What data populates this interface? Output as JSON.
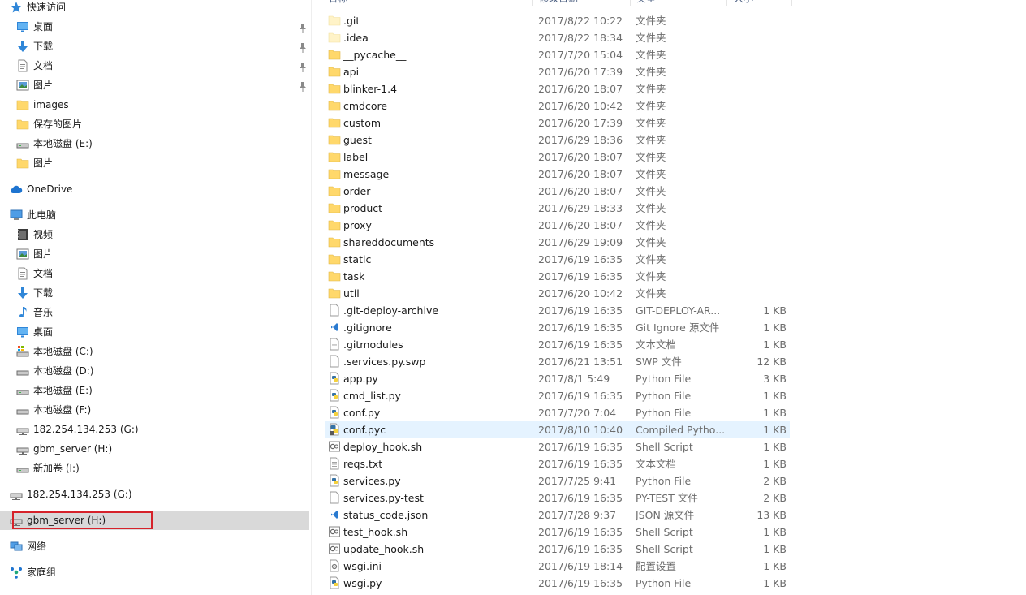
{
  "header": {
    "name": "名称",
    "date": "修改日期",
    "type": "类型",
    "size": "大小"
  },
  "colors": {
    "folder": "#ffd86b",
    "selection_nav": "#d9d9d9",
    "selection_row": "#e5f3ff",
    "focus_border": "#d6222a",
    "accent": "#1f6fcf"
  },
  "nav": [
    {
      "label": "快速访问",
      "icon": "star-icon",
      "indent": 0,
      "pinned": false
    },
    {
      "label": "桌面",
      "icon": "desktop-icon",
      "indent": 1,
      "pinned": true
    },
    {
      "label": "下载",
      "icon": "download-arrow-icon",
      "indent": 1,
      "pinned": true
    },
    {
      "label": "文档",
      "icon": "document-icon",
      "indent": 1,
      "pinned": true
    },
    {
      "label": "图片",
      "icon": "pictures-icon",
      "indent": 1,
      "pinned": true
    },
    {
      "label": "images",
      "icon": "folder-icon",
      "indent": 1,
      "pinned": false
    },
    {
      "label": "保存的图片",
      "icon": "folder-icon",
      "indent": 1,
      "pinned": false
    },
    {
      "label": "本地磁盘 (E:)",
      "icon": "drive-icon",
      "indent": 1,
      "pinned": false
    },
    {
      "label": "图片",
      "icon": "folder-icon",
      "indent": 1,
      "pinned": false
    },
    {
      "label": "OneDrive",
      "icon": "cloud-icon",
      "indent": 0,
      "pinned": false
    },
    {
      "label": "此电脑",
      "icon": "computer-icon",
      "indent": 0,
      "pinned": false
    },
    {
      "label": "视频",
      "icon": "video-icon",
      "indent": 1,
      "pinned": false
    },
    {
      "label": "图片",
      "icon": "pictures-icon",
      "indent": 1,
      "pinned": false
    },
    {
      "label": "文档",
      "icon": "document-icon",
      "indent": 1,
      "pinned": false
    },
    {
      "label": "下载",
      "icon": "download-arrow-icon",
      "indent": 1,
      "pinned": false
    },
    {
      "label": "音乐",
      "icon": "music-note-icon",
      "indent": 1,
      "pinned": false
    },
    {
      "label": "桌面",
      "icon": "desktop-icon",
      "indent": 1,
      "pinned": false
    },
    {
      "label": "本地磁盘 (C:)",
      "icon": "system-drive-icon",
      "indent": 1,
      "pinned": false
    },
    {
      "label": "本地磁盘 (D:)",
      "icon": "drive-icon",
      "indent": 1,
      "pinned": false
    },
    {
      "label": "本地磁盘 (E:)",
      "icon": "drive-icon",
      "indent": 1,
      "pinned": false
    },
    {
      "label": "本地磁盘 (F:)",
      "icon": "drive-icon",
      "indent": 1,
      "pinned": false
    },
    {
      "label": "182.254.134.253 (G:)",
      "icon": "network-drive-icon",
      "indent": 1,
      "pinned": false
    },
    {
      "label": "gbm_server (H:)",
      "icon": "network-drive-icon",
      "indent": 1,
      "pinned": false
    },
    {
      "label": "新加卷 (I:)",
      "icon": "drive-icon",
      "indent": 1,
      "pinned": false
    },
    {
      "label": "182.254.134.253 (G:)",
      "icon": "network-drive-icon",
      "indent": 0,
      "pinned": false
    },
    {
      "label": "gbm_server (H:)",
      "icon": "network-drive-icon",
      "indent": 0,
      "pinned": false,
      "selected": true
    },
    {
      "label": "网络",
      "icon": "network-icon",
      "indent": 0,
      "pinned": false
    },
    {
      "label": "家庭组",
      "icon": "homegroup-icon",
      "indent": 0,
      "pinned": false
    }
  ],
  "files": [
    {
      "name": ".git",
      "date": "2017/8/22 10:22",
      "type": "文件夹",
      "size": "",
      "icon": "folder-icon",
      "faded": true
    },
    {
      "name": ".idea",
      "date": "2017/8/22 18:34",
      "type": "文件夹",
      "size": "",
      "icon": "folder-icon",
      "faded": true
    },
    {
      "name": "__pycache__",
      "date": "2017/7/20 15:04",
      "type": "文件夹",
      "size": "",
      "icon": "folder-icon"
    },
    {
      "name": "api",
      "date": "2017/6/20 17:39",
      "type": "文件夹",
      "size": "",
      "icon": "folder-icon"
    },
    {
      "name": "blinker-1.4",
      "date": "2017/6/20 18:07",
      "type": "文件夹",
      "size": "",
      "icon": "folder-icon"
    },
    {
      "name": "cmdcore",
      "date": "2017/6/20 10:42",
      "type": "文件夹",
      "size": "",
      "icon": "folder-icon"
    },
    {
      "name": "custom",
      "date": "2017/6/20 17:39",
      "type": "文件夹",
      "size": "",
      "icon": "folder-icon"
    },
    {
      "name": "guest",
      "date": "2017/6/29 18:36",
      "type": "文件夹",
      "size": "",
      "icon": "folder-icon"
    },
    {
      "name": "label",
      "date": "2017/6/20 18:07",
      "type": "文件夹",
      "size": "",
      "icon": "folder-icon"
    },
    {
      "name": "message",
      "date": "2017/6/20 18:07",
      "type": "文件夹",
      "size": "",
      "icon": "folder-icon"
    },
    {
      "name": "order",
      "date": "2017/6/20 18:07",
      "type": "文件夹",
      "size": "",
      "icon": "folder-icon"
    },
    {
      "name": "product",
      "date": "2017/6/29 18:33",
      "type": "文件夹",
      "size": "",
      "icon": "folder-icon"
    },
    {
      "name": "proxy",
      "date": "2017/6/20 18:07",
      "type": "文件夹",
      "size": "",
      "icon": "folder-icon"
    },
    {
      "name": "shareddocuments",
      "date": "2017/6/29 19:09",
      "type": "文件夹",
      "size": "",
      "icon": "folder-icon"
    },
    {
      "name": "static",
      "date": "2017/6/19 16:35",
      "type": "文件夹",
      "size": "",
      "icon": "folder-icon"
    },
    {
      "name": "task",
      "date": "2017/6/19 16:35",
      "type": "文件夹",
      "size": "",
      "icon": "folder-icon"
    },
    {
      "name": "util",
      "date": "2017/6/20 10:42",
      "type": "文件夹",
      "size": "",
      "icon": "folder-icon"
    },
    {
      "name": ".git-deploy-archive",
      "date": "2017/6/19 16:35",
      "type": "GIT-DEPLOY-AR...",
      "size": "1 KB",
      "icon": "blank-file-icon"
    },
    {
      "name": ".gitignore",
      "date": "2017/6/19 16:35",
      "type": "Git Ignore 源文件",
      "size": "1 KB",
      "icon": "vscode-file-icon"
    },
    {
      "name": ".gitmodules",
      "date": "2017/6/19 16:35",
      "type": "文本文档",
      "size": "1 KB",
      "icon": "text-file-icon"
    },
    {
      "name": ".services.py.swp",
      "date": "2017/6/21 13:51",
      "type": "SWP 文件",
      "size": "12 KB",
      "icon": "blank-file-icon"
    },
    {
      "name": "app.py",
      "date": "2017/8/1 5:49",
      "type": "Python File",
      "size": "3 KB",
      "icon": "python-file-icon"
    },
    {
      "name": "cmd_list.py",
      "date": "2017/6/19 16:35",
      "type": "Python File",
      "size": "1 KB",
      "icon": "python-file-icon"
    },
    {
      "name": "conf.py",
      "date": "2017/7/20 7:04",
      "type": "Python File",
      "size": "1 KB",
      "icon": "python-file-icon"
    },
    {
      "name": "conf.pyc",
      "date": "2017/8/10 10:40",
      "type": "Compiled Pytho...",
      "size": "1 KB",
      "icon": "compiled-python-icon",
      "selected": true
    },
    {
      "name": "deploy_hook.sh",
      "date": "2017/6/19 16:35",
      "type": "Shell Script",
      "size": "1 KB",
      "icon": "shell-script-icon"
    },
    {
      "name": "reqs.txt",
      "date": "2017/6/19 16:35",
      "type": "文本文档",
      "size": "1 KB",
      "icon": "text-file-icon"
    },
    {
      "name": "services.py",
      "date": "2017/7/25 9:41",
      "type": "Python File",
      "size": "2 KB",
      "icon": "python-file-icon"
    },
    {
      "name": "services.py-test",
      "date": "2017/6/19 16:35",
      "type": "PY-TEST 文件",
      "size": "2 KB",
      "icon": "blank-file-icon"
    },
    {
      "name": "status_code.json",
      "date": "2017/7/28 9:37",
      "type": "JSON 源文件",
      "size": "13 KB",
      "icon": "vscode-file-icon"
    },
    {
      "name": "test_hook.sh",
      "date": "2017/6/19 16:35",
      "type": "Shell Script",
      "size": "1 KB",
      "icon": "shell-script-icon"
    },
    {
      "name": "update_hook.sh",
      "date": "2017/6/19 16:35",
      "type": "Shell Script",
      "size": "1 KB",
      "icon": "shell-script-icon"
    },
    {
      "name": "wsgi.ini",
      "date": "2017/6/19 18:14",
      "type": "配置设置",
      "size": "1 KB",
      "icon": "config-file-icon"
    },
    {
      "name": "wsgi.py",
      "date": "2017/6/19 16:35",
      "type": "Python File",
      "size": "1 KB",
      "icon": "python-file-icon"
    }
  ]
}
